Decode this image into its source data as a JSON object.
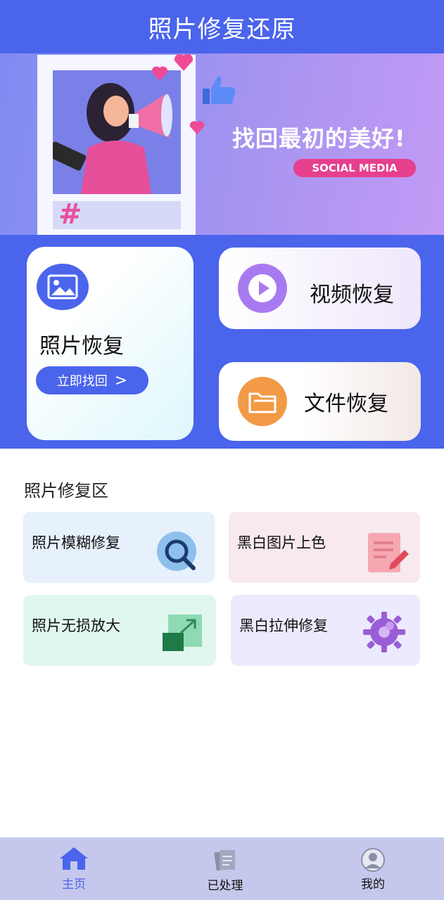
{
  "header": {
    "title": "照片修复还原"
  },
  "banner": {
    "slogan": "找回最初的美好!",
    "tag": "SOCIAL MEDIA",
    "hash": "#"
  },
  "features": {
    "photo": {
      "label": "照片恢复",
      "button": "立即找回",
      "arrow": ">"
    },
    "video": {
      "label": "视频恢复"
    },
    "file": {
      "label": "文件恢复"
    }
  },
  "section": {
    "title": "照片修复区"
  },
  "tools": [
    {
      "label": "照片模糊修复",
      "icon": "search-icon",
      "color": "#5A9FE0"
    },
    {
      "label": "黑白图片上色",
      "icon": "note-edit-icon",
      "color": "#E85A70"
    },
    {
      "label": "照片无损放大",
      "icon": "enlarge-icon",
      "color": "#2E8B57"
    },
    {
      "label": "黑白拉伸修复",
      "icon": "gear-icon",
      "color": "#8E44C9"
    }
  ],
  "tabbar": {
    "items": [
      {
        "label": "主页",
        "icon": "home-icon",
        "active": true
      },
      {
        "label": "已处理",
        "icon": "documents-icon",
        "active": false
      },
      {
        "label": "我的",
        "icon": "user-icon",
        "active": false
      }
    ]
  },
  "colors": {
    "primary": "#4A64EC",
    "tabbar": "#C5C8EC",
    "accent_pink": "#E63F8D"
  }
}
